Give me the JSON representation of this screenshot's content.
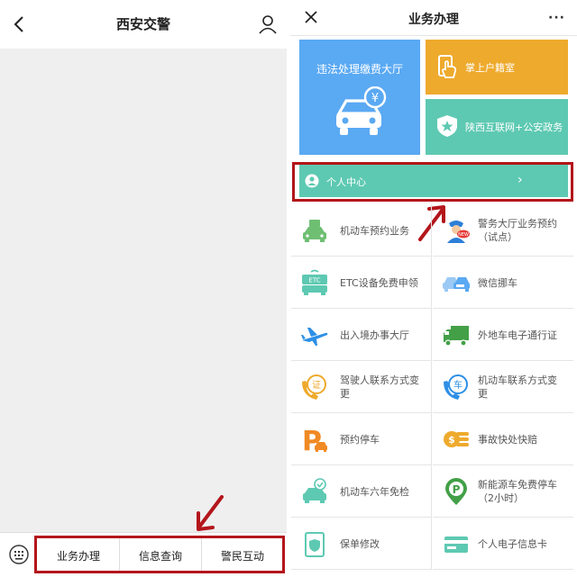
{
  "left": {
    "title": "西安交警",
    "menu": [
      "业务办理",
      "信息查询",
      "警民互动"
    ]
  },
  "right": {
    "title": "业务办理",
    "more": "···",
    "tiles": {
      "pay": "违法处理缴费大厅",
      "yen": "¥",
      "hukou": "掌上户籍室",
      "gov": "陕西互联网+公安政务"
    },
    "personal": {
      "label": "个人中心",
      "chevron": "›"
    },
    "services": [
      {
        "line1": "机动车预约业务",
        "line2": "",
        "color": "#6fbf73"
      },
      {
        "line1": "警务大厅业务预约",
        "line2": "（试点）",
        "color": "#2d7fd8",
        "badge": "NEW"
      },
      {
        "line1": "ETC设备免费申领",
        "line2": "",
        "color": "#5ec9b2",
        "badge": "ETC"
      },
      {
        "line1": "微信挪车",
        "line2": "",
        "color": "#5aa9f3"
      },
      {
        "line1": "出入境办事大厅",
        "line2": "",
        "color": "#2d8fe6"
      },
      {
        "line1": "外地车电子通行证",
        "line2": "",
        "color": "#43a047"
      },
      {
        "line1": "驾驶人联系方式变",
        "line2": "更",
        "color": "#eeaa2d",
        "badge": "证"
      },
      {
        "line1": "机动车联系方式变",
        "line2": "更",
        "color": "#2d8fe6",
        "badge": "车"
      },
      {
        "line1": "预约停车",
        "line2": "",
        "color": "#f08a24",
        "badge": "P"
      },
      {
        "line1": "事故快处快赔",
        "line2": "",
        "color": "#eeaa2d"
      },
      {
        "line1": "机动车六年免检",
        "line2": "",
        "color": "#5ec9b2"
      },
      {
        "line1": "新能源车免费停车",
        "line2": "（2小时）",
        "color": "#43a047",
        "badge": "P"
      },
      {
        "line1": "保单修改",
        "line2": "",
        "color": "#5ec9b2"
      },
      {
        "line1": "个人电子信息卡",
        "line2": "",
        "color": "#5ec9b2"
      }
    ]
  }
}
